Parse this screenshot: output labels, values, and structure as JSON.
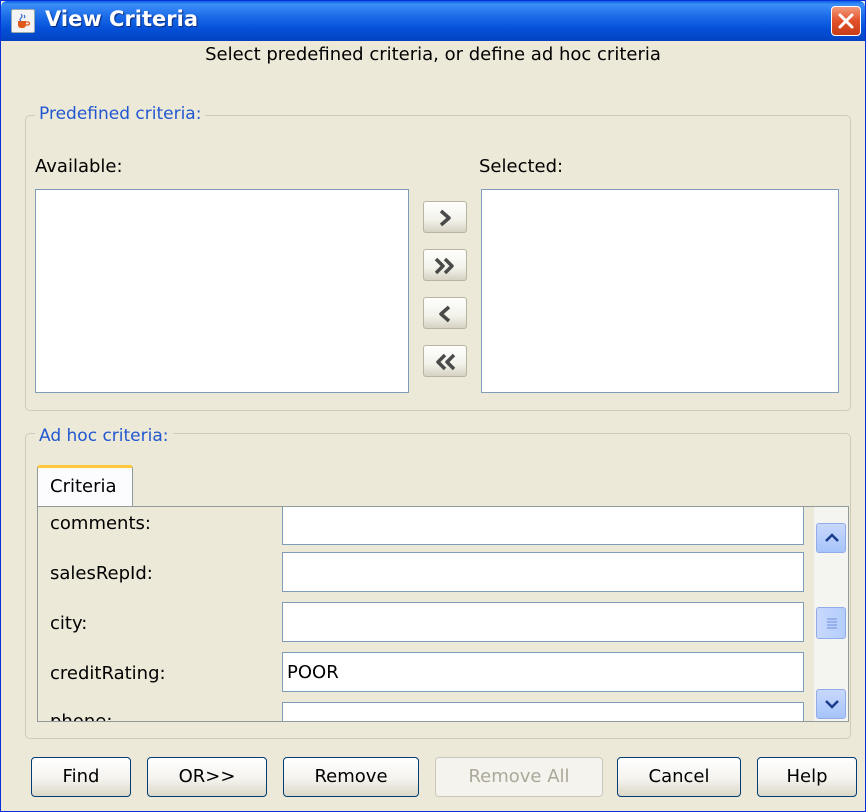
{
  "window": {
    "title": "View Criteria",
    "close_icon": "close-icon",
    "app_icon": "java-cup-icon"
  },
  "subtitle": "Select predefined criteria, or define ad hoc criteria",
  "predefined": {
    "legend": "Predefined criteria:",
    "available_label": "Available:",
    "selected_label": "Selected:",
    "move_buttons": [
      "move-right-icon",
      "move-all-right-icon",
      "move-left-icon",
      "move-all-left-icon"
    ]
  },
  "adhoc": {
    "legend": "Ad hoc criteria:",
    "tab_label": "Criteria",
    "rows": [
      {
        "label": "comments:",
        "value": ""
      },
      {
        "label": "salesRepId:",
        "value": ""
      },
      {
        "label": "city:",
        "value": ""
      },
      {
        "label": "creditRating:",
        "value": "POOR"
      },
      {
        "label": "phone:",
        "value": ""
      }
    ]
  },
  "buttons": {
    "find": "Find",
    "or": "OR>>",
    "remove": "Remove",
    "remove_all": "Remove All",
    "cancel": "Cancel",
    "help": "Help"
  },
  "colors": {
    "title_bar": "#0a5fe8",
    "group_label": "#2157d1",
    "window_bg": "#ece9d8"
  }
}
